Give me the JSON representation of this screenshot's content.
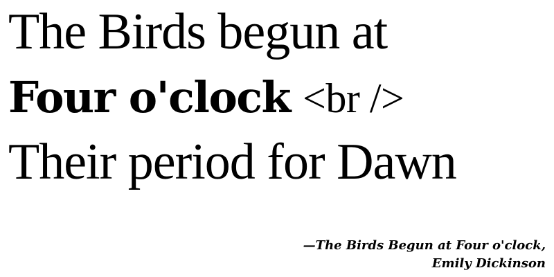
{
  "poem": {
    "line1": "The Birds begun at",
    "line2_bold": "Four o'clock",
    "line2_tag": "<br />",
    "line3": "Their period for Dawn"
  },
  "attribution": {
    "line1": "—The Birds Begun at Four o'clock,",
    "line2": "Emily Dickinson"
  }
}
